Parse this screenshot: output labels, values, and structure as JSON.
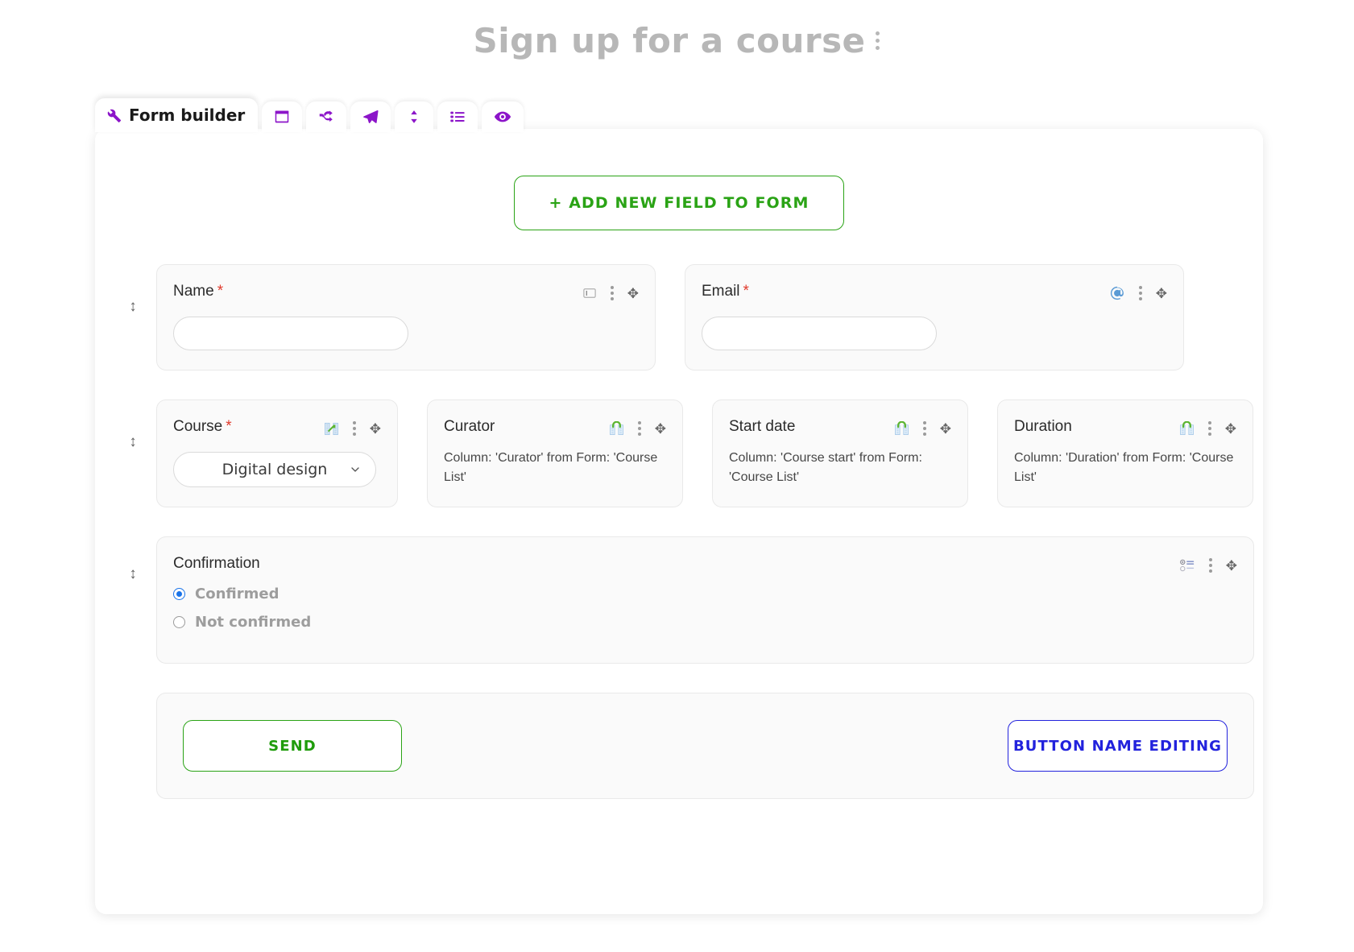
{
  "header": {
    "title": "Sign up for a course",
    "menu_icon": "kebab-menu-icon"
  },
  "tabs": {
    "active_label": "Form builder",
    "items": [
      {
        "label": "Form builder",
        "icon": "wrench-icon",
        "active": true
      },
      {
        "label": "",
        "icon": "window-icon",
        "active": false
      },
      {
        "label": "",
        "icon": "shuffle-icon",
        "active": false
      },
      {
        "label": "",
        "icon": "paper-plane-icon",
        "active": false
      },
      {
        "label": "",
        "icon": "sort-updown-icon",
        "active": false
      },
      {
        "label": "",
        "icon": "list-icon",
        "active": false
      },
      {
        "label": "",
        "icon": "eye-icon",
        "active": false
      }
    ]
  },
  "toolbar": {
    "add_field_label": "+ ADD NEW FIELD TO FORM"
  },
  "fields": {
    "name": {
      "label": "Name",
      "required_mark": "*",
      "value": "",
      "placeholder": "",
      "type_icon": "text-field-icon"
    },
    "email": {
      "label": "Email",
      "required_mark": "*",
      "value": "",
      "placeholder": "",
      "type_icon": "at-email-icon"
    },
    "course": {
      "label": "Course",
      "required_mark": "*",
      "selected": "Digital design",
      "type_icon": "linked-table-icon"
    },
    "curator": {
      "label": "Curator",
      "description": "Column: 'Curator' from Form: 'Course List'",
      "type_icon": "linked-form-icon"
    },
    "start_date": {
      "label": "Start date",
      "description": "Column: 'Course start' from Form: 'Course List'",
      "type_icon": "linked-form-icon"
    },
    "duration": {
      "label": "Duration",
      "description": "Column: 'Duration' from Form: 'Course List'",
      "type_icon": "linked-form-icon"
    },
    "confirmation": {
      "label": "Confirmation",
      "type_icon": "radio-list-icon",
      "options": [
        {
          "label": "Confirmed",
          "selected": true
        },
        {
          "label": "Not confirmed",
          "selected": false
        }
      ]
    }
  },
  "actions": {
    "send_label": "SEND",
    "edit_button_label": "BUTTON NAME EDITING"
  },
  "colors": {
    "green": "#2aa315",
    "blue": "#2222dd",
    "purple": "#8c15c9",
    "required_red": "#e0392b",
    "radio_blue": "#1a73e8",
    "title_gray": "#b7b7b7"
  }
}
